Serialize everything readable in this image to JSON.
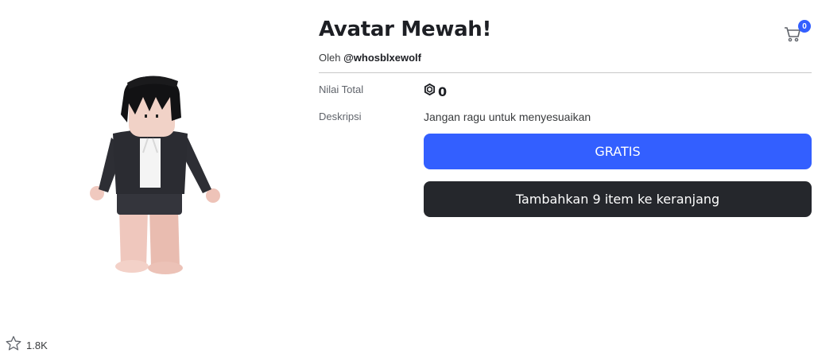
{
  "item": {
    "title": "Avatar Mewah!",
    "by_prefix": "Oleh",
    "creator": "@whosblxewolf"
  },
  "cart": {
    "icon": "shopping-cart-icon",
    "count": "0"
  },
  "details": {
    "price_label": "Nilai Total",
    "price_icon": "robux-icon",
    "price_value": "0",
    "description_label": "Deskripsi",
    "description": "Jangan ragu untuk menyesuaikan"
  },
  "actions": {
    "get_free_label": "GRATIS",
    "add_to_cart_label": "Tambahkan 9 item ke keranjang"
  },
  "favorites": {
    "icon": "star-outline-icon",
    "count": "1.8K"
  },
  "colors": {
    "primary_button": "#335fff",
    "secondary_button": "#25272c",
    "badge": "#335fff"
  }
}
